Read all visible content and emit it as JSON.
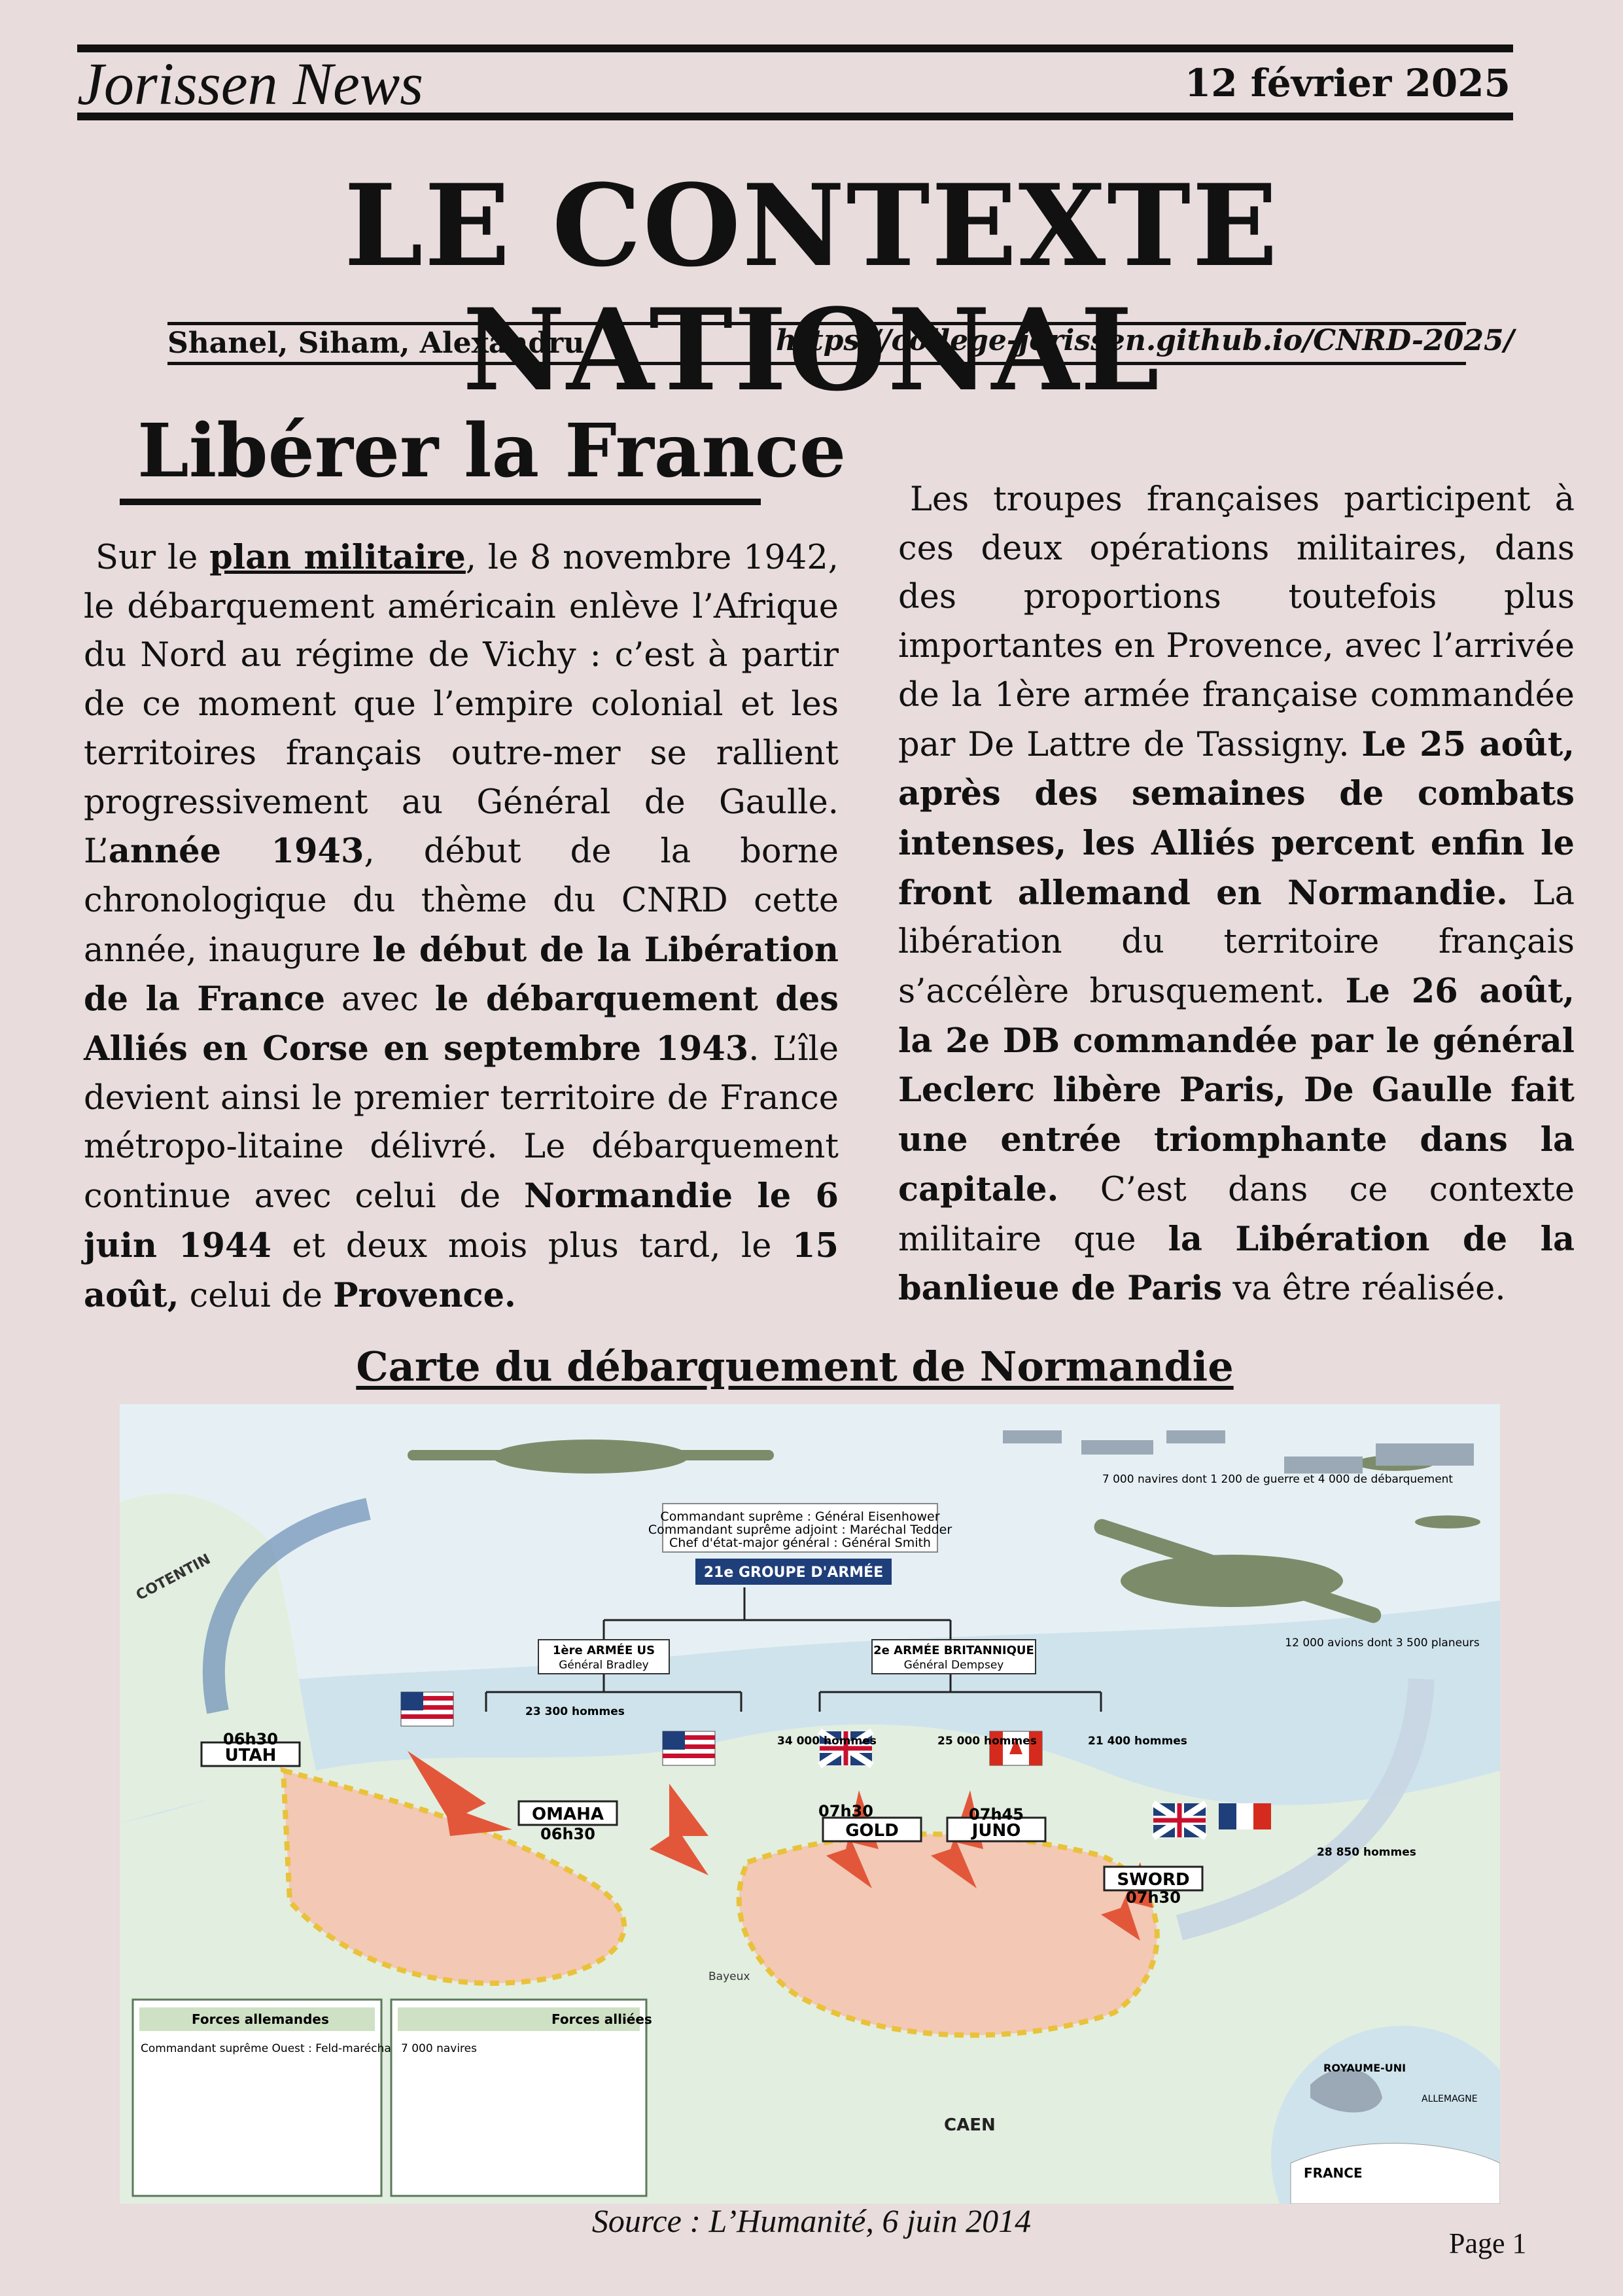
{
  "masthead": {
    "name": "Jorissen News",
    "date": "12 février 2025"
  },
  "headline": "LE CONTEXTE NATIONAL",
  "byline": {
    "authors": "Shanel, Siham, Alexandru",
    "url": "https://college-jorissen.github.io/CNRD-2025/"
  },
  "section_title": "Libérer la France",
  "left_column": [
    {
      "t": "Sur le ",
      "s": "n"
    },
    {
      "t": "plan militaire",
      "s": "bu"
    },
    {
      "t": ", le 8 novembre 1942, le débarquement américain enlève l’Afrique du Nord au régime de Vichy : c’est à partir de ce moment que l’empire colonial et les territoires français outre-mer se rallient progressivement au Général de Gaulle. L’",
      "s": "n"
    },
    {
      "t": "année 1943",
      "s": "b"
    },
    {
      "t": ", début de la borne chronologique du thème du CNRD cette année, inaugure ",
      "s": "n"
    },
    {
      "t": "le début de la Libération de la France",
      "s": "b"
    },
    {
      "t": " avec ",
      "s": "n"
    },
    {
      "t": "le débarquement des Alliés en Corse en septembre 1943",
      "s": "b"
    },
    {
      "t": ". L’île devient ainsi le premier territoire de France métropo-litaine délivré. Le débarquement continue avec celui de ",
      "s": "n"
    },
    {
      "t": "Normandie le 6 juin 1944",
      "s": "b"
    },
    {
      "t": " et deux mois plus tard, le ",
      "s": "n"
    },
    {
      "t": "15 août,",
      "s": "b"
    },
    {
      "t": " celui de ",
      "s": "n"
    },
    {
      "t": "Provence.",
      "s": "b"
    }
  ],
  "right_column": [
    {
      "t": "Les troupes françaises participent à ces deux opérations militaires, dans des proportions toutefois plus importantes en Provence, avec l’arrivée de la 1ère armée française commandée par De Lattre de Tassigny. ",
      "s": "n"
    },
    {
      "t": "Le 25 août, après des semaines de combats intenses, les Alliés percent enfin le front allemand en Normandie.",
      "s": "b"
    },
    {
      "t": " La libération du territoire français s’accélère brusquement. ",
      "s": "n"
    },
    {
      "t": "Le 26 août, la 2e DB commandée par le général Leclerc libère Paris, De Gaulle fait une entrée triomphante dans la capitale.",
      "s": "b"
    },
    {
      "t": " C’est dans ce contexte militaire que ",
      "s": "n"
    },
    {
      "t": "la Libération de la banlieue de Paris",
      "s": "b"
    },
    {
      "t": " va être réalisée.",
      "s": "n"
    }
  ],
  "map": {
    "title": "Carte du débarquement de Normandie",
    "source": "Source : L’Humanité, 6 juin 2014",
    "beaches": [
      {
        "name": "UTAH",
        "time": "06h30",
        "troops": "23 300 hommes"
      },
      {
        "name": "OMAHA",
        "time": "06h30",
        "troops": "34 000 hommes"
      },
      {
        "name": "GOLD",
        "time": "07h30",
        "troops": "25 000 hommes"
      },
      {
        "name": "JUNO",
        "time": "07h45",
        "troops": "21 400 hommes"
      },
      {
        "name": "SWORD",
        "time": "07h30",
        "troops": "28 850 hommes"
      }
    ],
    "command": {
      "header": "21e GROUPE D'ARMÉE",
      "supreme": "Commandant suprême : Général Eisenhower",
      "deputy": "Commandant suprême adjoint : Maréchal Tedder",
      "chief": "Chef d'état-major général : Général Smith",
      "us_army": "1ère ARMÉE US",
      "us_general": "Général Bradley",
      "uk_army": "2e ARMÉE BRITANNIQUE",
      "uk_general": "Général Dempsey"
    },
    "places": [
      "COTENTIN",
      "CAEN",
      "Bayeux",
      "ROYAUME-UNI",
      "FRANCE",
      "ALLEMAGNE"
    ],
    "fleet": "7 000 navires dont 1 200 de guerre et 4 000 de débarquement",
    "aircraft": "12 000 avions dont 3 500 planeurs",
    "german_box_title": "Forces allemandes",
    "german_box_text": "Commandant suprême Ouest : Feld-maréchal von Rundstedt",
    "allied_box_title": "Forces alliées",
    "allied_box_text": "7 000 navires",
    "colors": {
      "sea": "#cfe3ec",
      "land": "#e2eee0",
      "beachhead": "#f3c8b5",
      "arrow": "#e2573a",
      "navy": "#1f3f7a"
    }
  },
  "page": "Page 1"
}
